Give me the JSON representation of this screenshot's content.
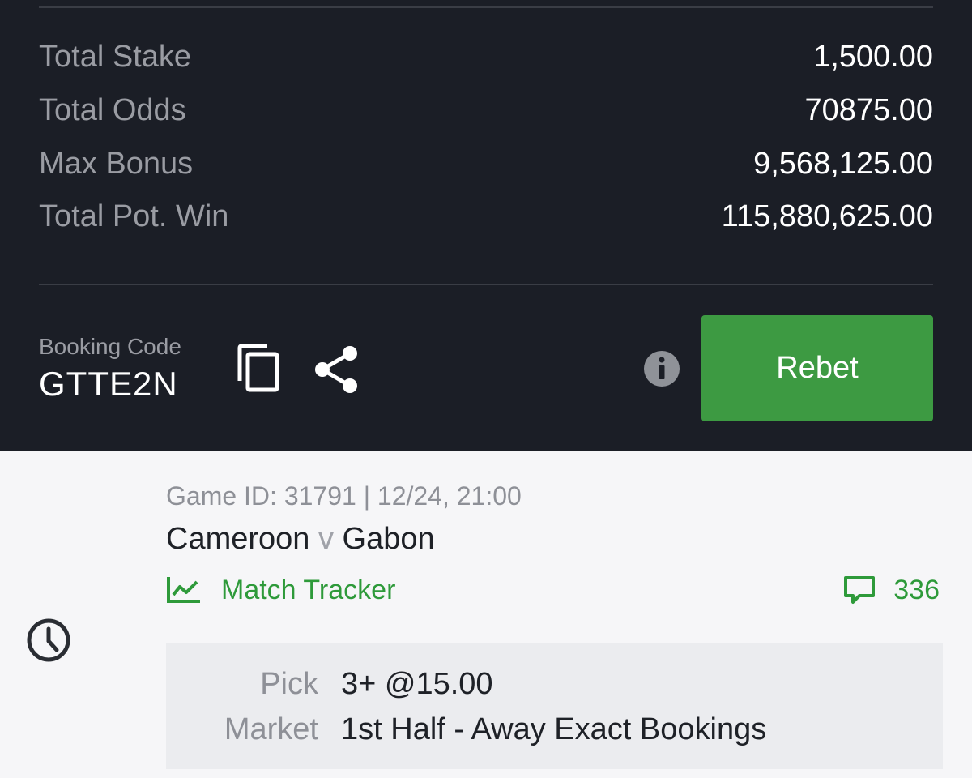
{
  "summary": {
    "total_stake_label": "Total Stake",
    "total_stake_value": "1,500.00",
    "total_odds_label": "Total Odds",
    "total_odds_value": "70875.00",
    "max_bonus_label": "Max Bonus",
    "max_bonus_value": "9,568,125.00",
    "pot_win_label": "Total Pot. Win",
    "pot_win_value": "115,880,625.00"
  },
  "booking": {
    "label": "Booking Code",
    "code": "GTTE2N",
    "rebet_label": "Rebet"
  },
  "game": {
    "meta": "Game ID: 31791 | 12/24, 21:00",
    "home": "Cameroon",
    "vs": "v",
    "away": "Gabon",
    "tracker_label": "Match Tracker",
    "comments_count": "336",
    "pick_label": "Pick",
    "pick_value": "3+ @15.00",
    "market_label": "Market",
    "market_value": "1st Half - Away Exact Bookings"
  },
  "colors": {
    "dark_bg": "#1b1e26",
    "accent_green": "#3d9a42",
    "light_bg": "#f6f6f8"
  },
  "icons": [
    "copy-icon",
    "share-icon",
    "info-icon",
    "clock-icon",
    "match-tracker-icon",
    "comment-icon"
  ]
}
